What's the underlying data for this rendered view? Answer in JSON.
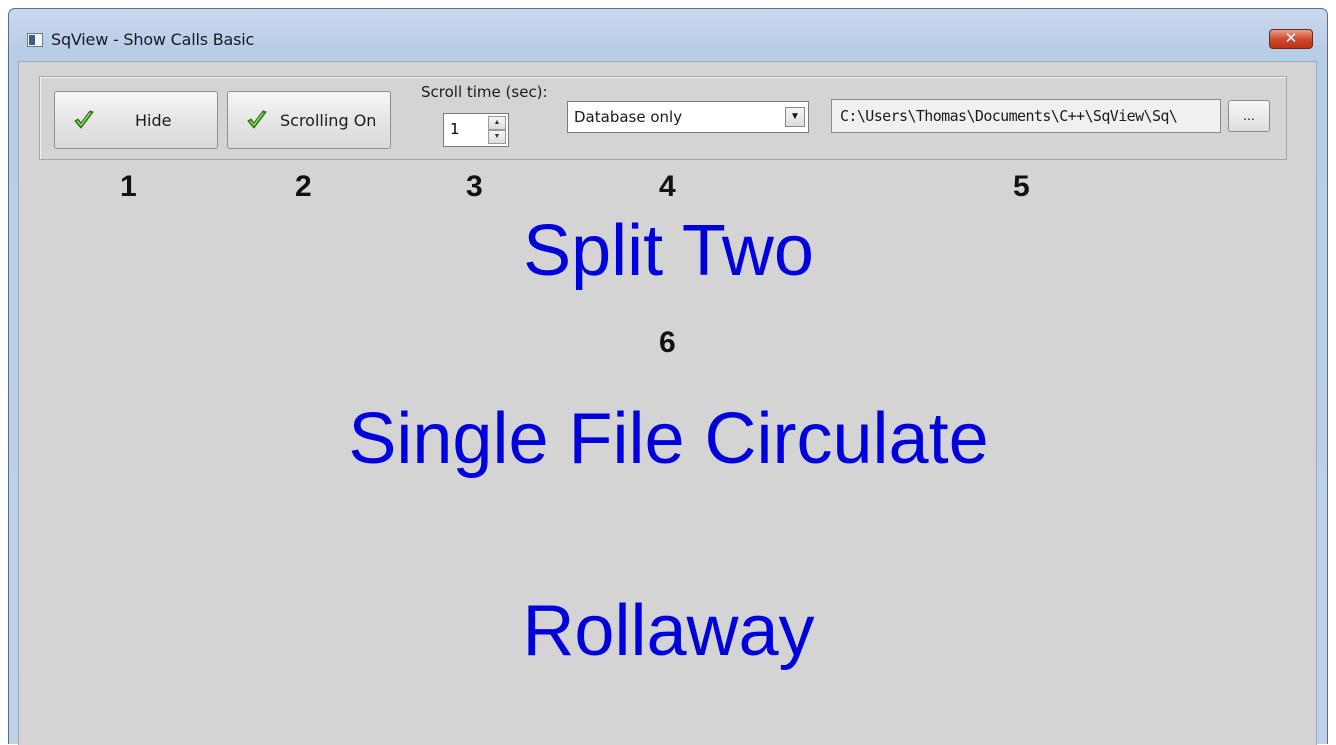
{
  "window": {
    "title": "SqView - Show Calls Basic",
    "close_glyph": "✕"
  },
  "toolbar": {
    "hide_label": "Hide",
    "scrolling_label": "Scrolling On",
    "scroll_time_label": "Scroll time (sec):",
    "scroll_time_value": "1",
    "mode_value": "Database only",
    "path_value": "C:\\Users\\Thomas\\Documents\\C++\\SqView\\Sq\\",
    "browse_label": "..."
  },
  "annotations": {
    "n1": "1",
    "n2": "2",
    "n3": "3",
    "n4": "4",
    "n5": "5",
    "n6": "6"
  },
  "display": {
    "line1": "Split Two",
    "line2": "Single File Circulate",
    "line3": "Rollaway"
  },
  "colors": {
    "display_text": "#0000dd",
    "background": "#d4d4d4"
  }
}
